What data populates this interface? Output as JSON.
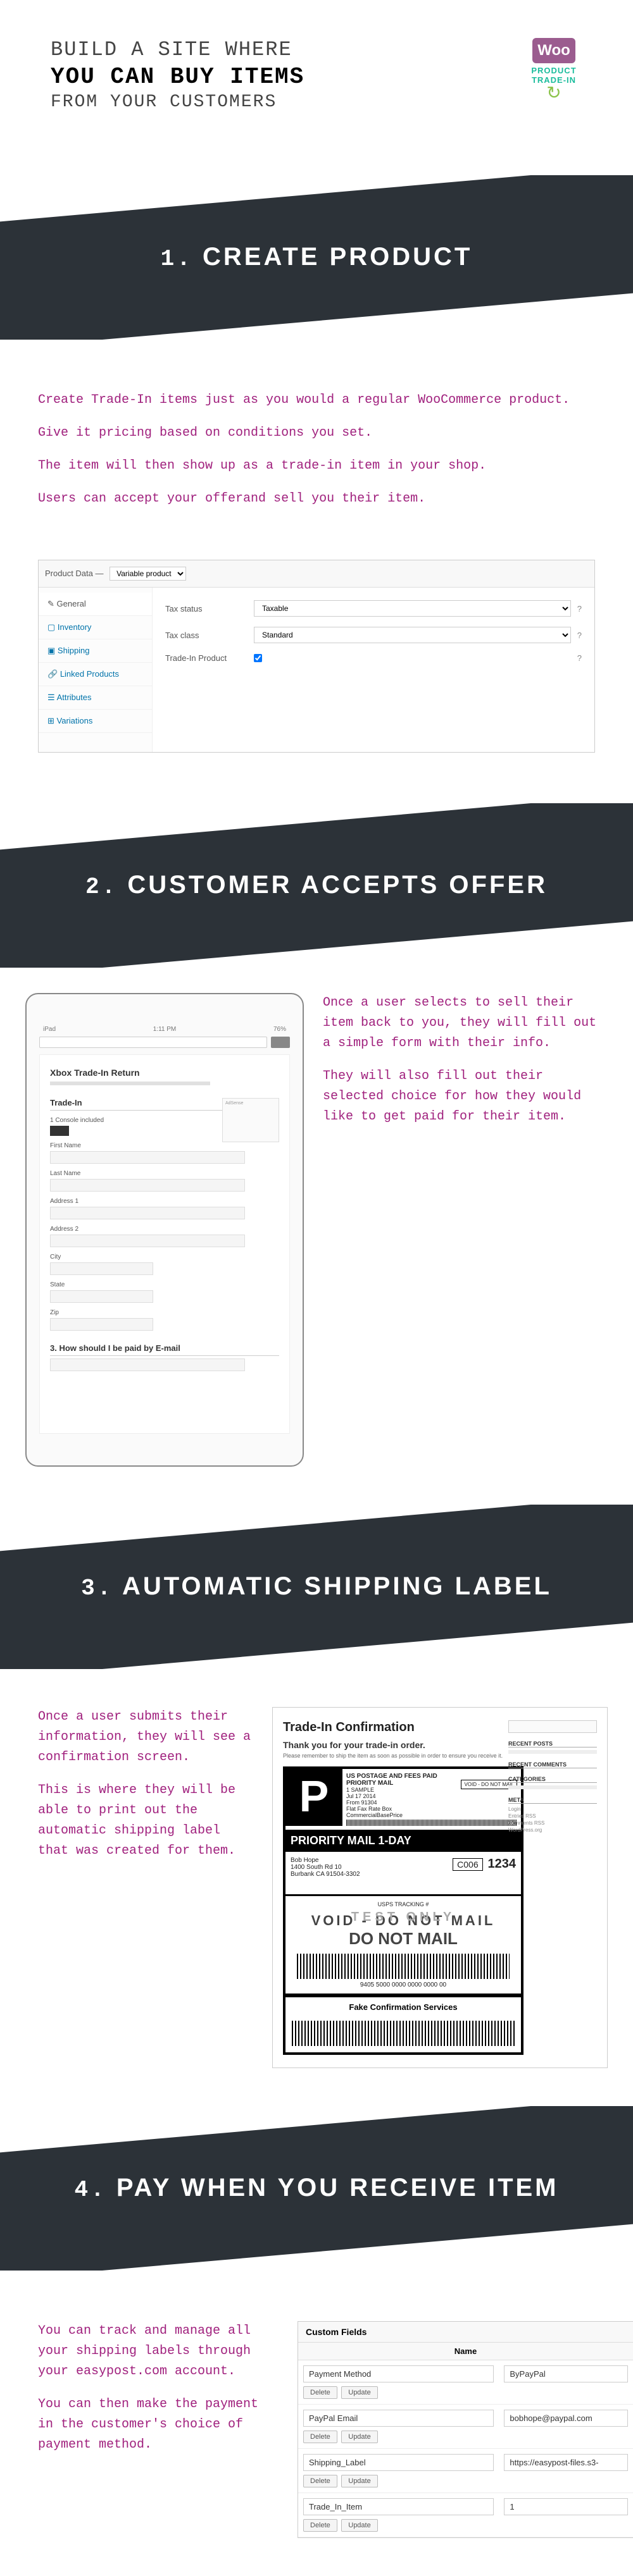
{
  "header": {
    "line1": "BUILD A SITE WHERE",
    "line2": "YOU CAN BUY ITEMS",
    "line3": "FROM YOUR CUSTOMERS"
  },
  "logo": {
    "brand": "Woo",
    "product": "PRODUCT TRADE-IN"
  },
  "steps": [
    {
      "num": "1.",
      "title": "CREATE PRODUCT"
    },
    {
      "num": "2.",
      "title": "CUSTOMER ACCEPTS OFFER"
    },
    {
      "num": "3.",
      "title": "AUTOMATIC SHIPPING LABEL"
    },
    {
      "num": "4.",
      "title": "PAY WHEN YOU RECEIVE ITEM"
    }
  ],
  "section1": {
    "paragraphs": [
      "Create Trade-In items just as you would a regular WooCommerce product.",
      "Give it pricing based on conditions you set.",
      "The item will then show up as a trade-in item in your shop.",
      "Users can accept your offerand sell you their item."
    ],
    "mockup": {
      "header_label": "Product Data —",
      "header_select": "Variable product",
      "sidebar": [
        "General",
        "Inventory",
        "Shipping",
        "Linked Products",
        "Attributes",
        "Variations"
      ],
      "sidebar_icons": [
        "✎",
        "▢",
        "▣",
        "🔗",
        "☰",
        "⊞"
      ],
      "rows": [
        {
          "label": "Tax status",
          "value": "Taxable",
          "help": "?"
        },
        {
          "label": "Tax class",
          "value": "Standard",
          "help": "?"
        },
        {
          "label": "Trade-In Product",
          "checked": true,
          "help": "?"
        }
      ]
    }
  },
  "section2": {
    "ipad": {
      "status_left": "iPad",
      "status_center": "1:11 PM",
      "status_right": "76%",
      "title": "Xbox Trade-In Return",
      "form_header": "Trade-In",
      "sub": "1 Console included",
      "fields": [
        "First Name",
        "Last Name",
        "Address 1",
        "Address 2",
        "City",
        "State",
        "Zip"
      ],
      "paypal_q": "3. How should I be paid by E-mail"
    },
    "paragraphs": [
      "Once a user selects to sell their item back to you, they will fill out a simple form with their info.",
      "They will also fill out their selected choice for how they would like to get paid for their item."
    ]
  },
  "section3": {
    "paragraphs": [
      "Once a user submits their information, they will see a confirmation screen.",
      "This is where they will be able to print out the automatic shipping label that was created for them."
    ],
    "label": {
      "title": "Trade-In Confirmation",
      "subtitle": "Thank you for your trade-in order.",
      "instruction": "Please remember to ship the item as soon as possible in order to ensure you receive it.",
      "p": "P",
      "postage_line1": "US POSTAGE AND FEES PAID",
      "postage_line2": "PRIORITY MAIL",
      "postage_line3": "1 SAMPLE",
      "postage_line4": "Jul 17 2014",
      "postage_line5": "From 91304",
      "postage_line6": "Flat Fax Rate Box",
      "postage_company": "CommercialBasePrice",
      "void_badge": "VOID - DO NOT MAIL",
      "priority_bar": "PRIORITY MAIL 1-DAY",
      "addr_name": "Bob Hope",
      "addr_line1": "1400 South Rd 10",
      "addr_line2": "Burbank CA 91504-3302",
      "code1": "C006",
      "code2": "1234",
      "track_label": "USPS TRACKING #",
      "stamp1": "TEST ONLY",
      "void_body1": "VOID - DO NOT MAIL",
      "void_body2": "DO NOT MAIL",
      "track_num": "9405 5000 0000 0000 0000 00",
      "fake": "Fake Confirmation Services",
      "sidebar": {
        "recent_posts": "RECENT POSTS",
        "recent_comments": "RECENT COMMENTS",
        "categories": "CATEGORIES",
        "meta": "META",
        "meta_items": [
          "Login",
          "Entries RSS",
          "Comments RSS",
          "WordPress.org"
        ]
      }
    }
  },
  "section4": {
    "paragraphs": [
      "You can track and manage all your shipping labels through your easypost.com account.",
      "You can then make the payment in the customer's choice of payment method."
    ],
    "panel": {
      "title": "Custom Fields",
      "col1": "Name",
      "rows": [
        {
          "name": "Payment Method",
          "value": "ByPayPal"
        },
        {
          "name": "PayPal Email",
          "value": "bobhope@paypal.com"
        },
        {
          "name": "Shipping_Label",
          "value": "https://easypost-files.s3-"
        },
        {
          "name": "Trade_In_Item",
          "value": "1"
        }
      ],
      "btn_delete": "Delete",
      "btn_update": "Update"
    }
  }
}
